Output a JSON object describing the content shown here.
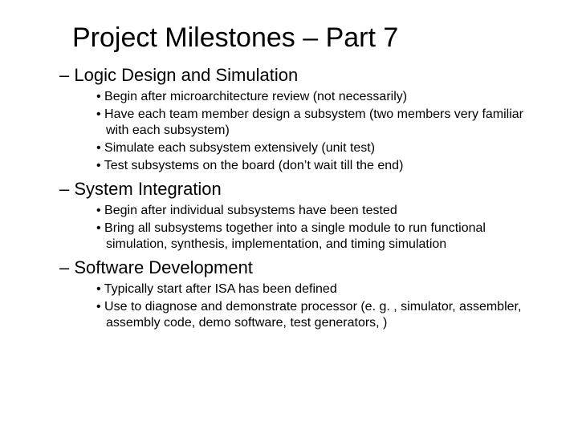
{
  "title": "Project Milestones – Part 7",
  "sections": [
    {
      "heading": "Logic Design and Simulation",
      "items": [
        "Begin after microarchitecture review (not necessarily)",
        "Have each team member design a subsystem (two members very familiar with each subsystem)",
        "Simulate each subsystem extensively (unit test)",
        "Test subsystems on the board (don’t wait till the end)"
      ]
    },
    {
      "heading": "System Integration",
      "items": [
        "Begin after individual subsystems have been tested",
        "Bring all subsystems together into a single module to run functional simulation, synthesis, implementation, and timing simulation"
      ]
    },
    {
      "heading": "Software Development",
      "items": [
        "Typically start after ISA has been defined",
        "Use to diagnose and demonstrate processor (e. g. , simulator, assembler, assembly code, demo software, test generators, )"
      ]
    }
  ]
}
